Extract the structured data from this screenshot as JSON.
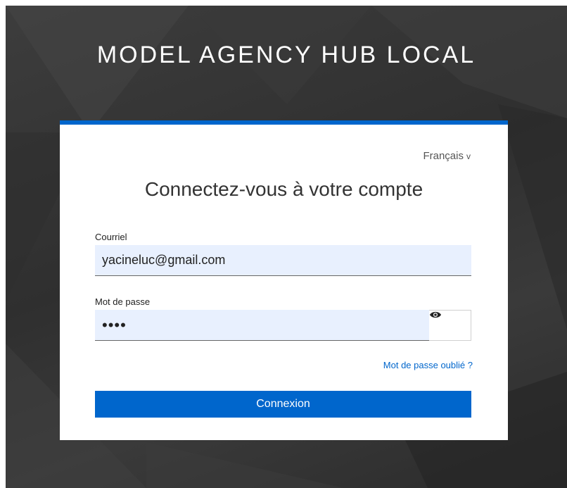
{
  "app": {
    "title": "MODEL AGENCY HUB LOCAL"
  },
  "login": {
    "language": "Français",
    "heading": "Connectez-vous à votre compte",
    "email_label": "Courriel",
    "email_value": "yacineluc@gmail.com",
    "password_label": "Mot de passe",
    "password_masked": "••••",
    "forgot_link": "Mot de passe oublié ?",
    "submit_label": "Connexion"
  },
  "icons": {
    "language_toggle": "chevron-down-icon",
    "show_password": "eye-icon"
  },
  "colors": {
    "accent": "#0066cc",
    "input_bg": "#e8f0fe",
    "background": "#333333"
  }
}
